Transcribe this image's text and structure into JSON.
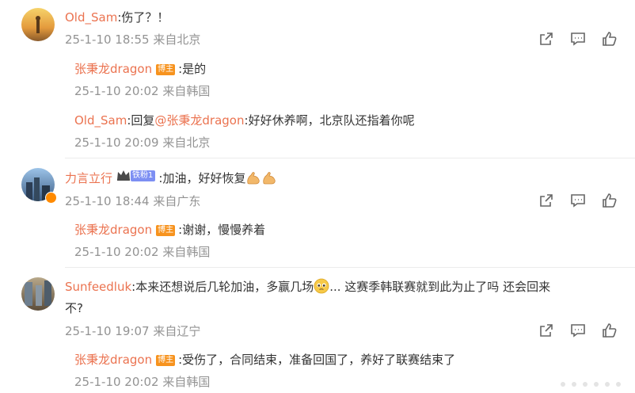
{
  "comments": [
    {
      "username": "Old_Sam",
      "text": "伤了？！",
      "date": "25-1-10 18:55",
      "location": "来自北京",
      "replies": [
        {
          "username": "张秉龙dragon",
          "badge": "博主",
          "text": "是的",
          "date": "25-1-10 20:02",
          "location": "来自韩国"
        },
        {
          "username": "Old_Sam",
          "reply_prefix": "回复",
          "mention": "@张秉龙dragon",
          "text": "好好休养啊，北京队还指着你呢",
          "date": "25-1-10 20:09",
          "location": "来自北京"
        }
      ]
    },
    {
      "username": "力言立行",
      "fan_badge": "铁粉1",
      "text": "加油，好好恢复",
      "date": "25-1-10 18:44",
      "location": "来自广东",
      "replies": [
        {
          "username": "张秉龙dragon",
          "badge": "博主",
          "text": "谢谢，慢慢养着",
          "date": "25-1-10 20:02",
          "location": "来自韩国"
        }
      ]
    },
    {
      "username": "Sunfeedluk",
      "text_line1": "本来还想说后几轮加油，多赢几场",
      "text_line1b": "... 这赛季韩联赛就到此为止了吗 还会回来",
      "text_line2": "不?",
      "date": "25-1-10 19:07",
      "location": "来自辽宁",
      "replies": [
        {
          "username": "张秉龙dragon",
          "badge": "博主",
          "text": "受伤了，合同结束，准备回国了，养好了联赛结束了",
          "date": "25-1-10 20:02",
          "location": "来自韩国"
        }
      ]
    }
  ],
  "colors": {
    "username": "#eb7350",
    "meta": "#939393",
    "text": "#333333",
    "host_badge": "#f7931e",
    "fan_badge": "#7d8ff3"
  },
  "icons": [
    "share-icon",
    "comment-icon",
    "like-icon"
  ]
}
